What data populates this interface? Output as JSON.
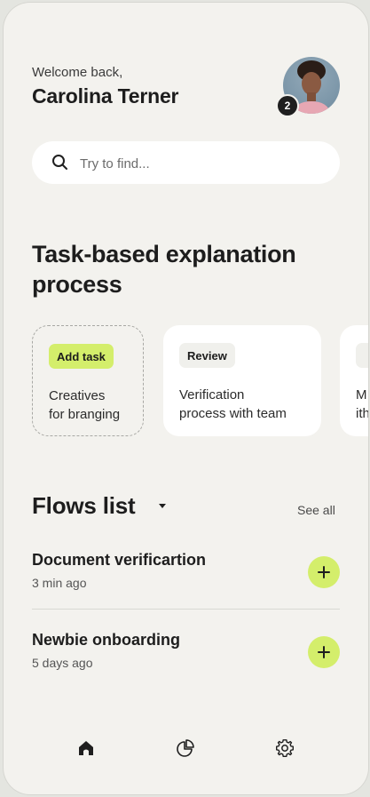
{
  "header": {
    "greeting": "Welcome back,",
    "user_name": "Carolina Terner",
    "notification_count": "2"
  },
  "search": {
    "placeholder": "Try to find..."
  },
  "section": {
    "title": "Task-based explanation process"
  },
  "cards": [
    {
      "chip": "Add task",
      "text_line1": "Creatives",
      "text_line2": "for branging"
    },
    {
      "chip": "Review",
      "text_line1": "Verification",
      "text_line2": "process with team"
    },
    {
      "text_line1": "M",
      "text_line2": "ith"
    }
  ],
  "flows": {
    "title": "Flows list",
    "see_all": "See all",
    "items": [
      {
        "name": "Document verificartion",
        "time": "3 min ago"
      },
      {
        "name": "Newbie onboarding",
        "time": "5 days ago"
      }
    ]
  },
  "nav": {
    "items": [
      "home-icon",
      "chart-icon",
      "gear-icon"
    ]
  },
  "colors": {
    "accent": "#d4ee6b",
    "background": "#f3f2ee",
    "card": "#ffffff"
  }
}
